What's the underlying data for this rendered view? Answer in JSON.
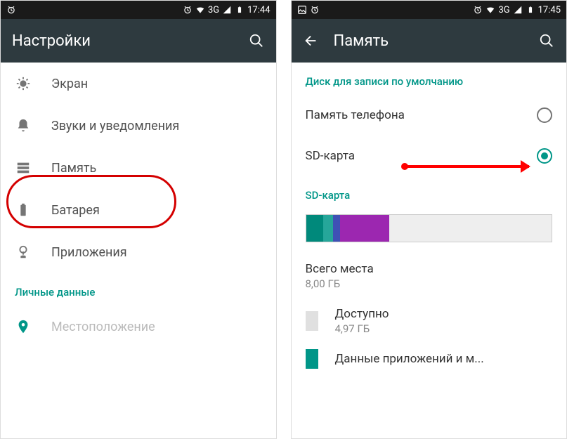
{
  "left": {
    "status": {
      "net": "3G",
      "time": "17:44"
    },
    "appbar": {
      "title": "Настройки"
    },
    "items": [
      {
        "icon": "brightness",
        "label": "Экран"
      },
      {
        "icon": "bell",
        "label": "Звуки и уведомления"
      },
      {
        "icon": "storage",
        "label": "Память"
      },
      {
        "icon": "battery",
        "label": "Батарея"
      },
      {
        "icon": "apps",
        "label": "Приложения"
      }
    ],
    "section": "Личные данные",
    "items2": [
      {
        "icon": "location",
        "label": "Местоположение"
      }
    ]
  },
  "right": {
    "status": {
      "net": "3G",
      "time": "17:45"
    },
    "appbar": {
      "title": "Память"
    },
    "section_default": "Диск для записи по умолчанию",
    "radios": [
      {
        "label": "Память телефона",
        "checked": false
      },
      {
        "label": "SD-карта",
        "checked": true
      }
    ],
    "section_sd": "SD-карта",
    "storage_segments": [
      {
        "color": "#00897b",
        "pct": 7
      },
      {
        "color": "#26a69a",
        "pct": 4
      },
      {
        "color": "#3f51b5",
        "pct": 3
      },
      {
        "color": "#9c27b0",
        "pct": 20
      },
      {
        "color": "#e0e0e0",
        "pct": 66
      }
    ],
    "total": {
      "label": "Всего места",
      "value": "8,00 ГБ"
    },
    "rows": [
      {
        "color": "#e0e0e0",
        "label": "Доступно",
        "value": "4,97 ГБ"
      },
      {
        "color": "#009688",
        "label": "Данные приложений и м..."
      }
    ]
  }
}
